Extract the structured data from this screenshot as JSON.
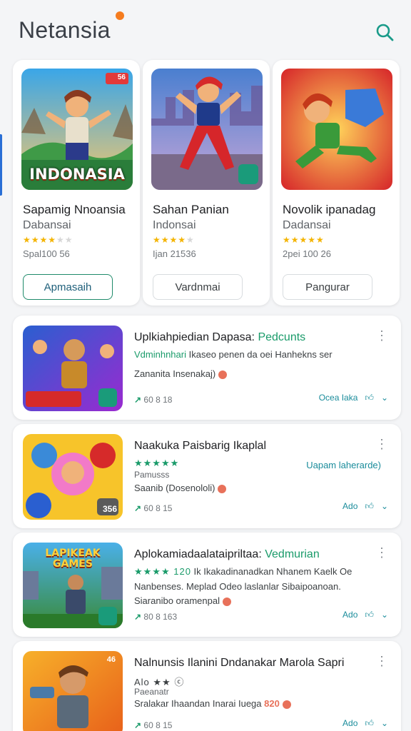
{
  "app": {
    "title": "Netansia"
  },
  "icons": {
    "search": "search-icon",
    "more": "more-vert-icon",
    "like": "thumbs-up-icon",
    "expand": "chevron-down-icon",
    "share": "share-icon"
  },
  "colors": {
    "accent_green": "#1a9b6a",
    "accent_teal": "#1a8c9b",
    "brand_dot": "#f57c1f",
    "star_gold": "#f4b400"
  },
  "featured": [
    {
      "title": "Sapamig Nnoansia",
      "subtitle": "Dabansai",
      "rating_stars": 3.5,
      "meta": "Spal100 56",
      "button": "Apmasaih",
      "art_label": "INDONASIA",
      "badge": "56"
    },
    {
      "title": "Sahan Panian",
      "subtitle": "Indonsai",
      "rating_stars": 3.5,
      "meta": "Ijan 21536",
      "button": "Vardnmai",
      "art_label": "",
      "badge": ""
    },
    {
      "title": "Novolik ipanadag",
      "subtitle": "Dadansai",
      "rating_stars": 5,
      "meta": "2pei 100 26",
      "button": "Pangurar",
      "art_label": "",
      "badge": ""
    }
  ],
  "list": [
    {
      "title": "Uplkiahpiedian Dapasa:",
      "tag": "Pedcunts",
      "line2_green": "Vdminhnhari",
      "line2_rest": "Ikaseo penen da oei Hanhekns ser",
      "line3": "Zananita Insenakaj)",
      "side": "",
      "stats": "60 8 18",
      "action_text": "Ocea  Iaka",
      "thumb_badge": ""
    },
    {
      "title": "Naakuka Paisbarig Ikaplal",
      "tag": "",
      "line2_green": "★★★★★",
      "line2_rest": "Pamusss",
      "line3": "Saanib (Dosenololi)",
      "side": "Uapam laherarde)",
      "stats": "60 8 15",
      "action_text": "Ado",
      "thumb_badge": "356"
    },
    {
      "title": "Aplokamiadaalataipriltaa:",
      "tag": "Vedmurian",
      "line2_green": "★★★★ 120",
      "line2_rest": "Ik Ikakadinanadkan Nhanem Kaelk Oe",
      "line3": "Nanbenses. Meplad Odeo laslanlar Sibaipoanoan.",
      "line4": "Siaranibo oramenpal",
      "side": "",
      "stats": "80 8 163",
      "action_text": "Ado",
      "thumb_badge": "",
      "art_label": "LAPIKEAK GAMES"
    },
    {
      "title": "Nalnunsis Ilanini Dndanakar Marola Sapri",
      "tag": "",
      "line2_green": "Alo ★★ ⓒ",
      "line2_rest": "Paeanatr",
      "line3": "Sralakar Ihaandan Inarai Iuega",
      "line3_extra": "820",
      "side": "",
      "stats": "60 8 15",
      "action_text": "Ado",
      "thumb_badge": "46"
    }
  ]
}
